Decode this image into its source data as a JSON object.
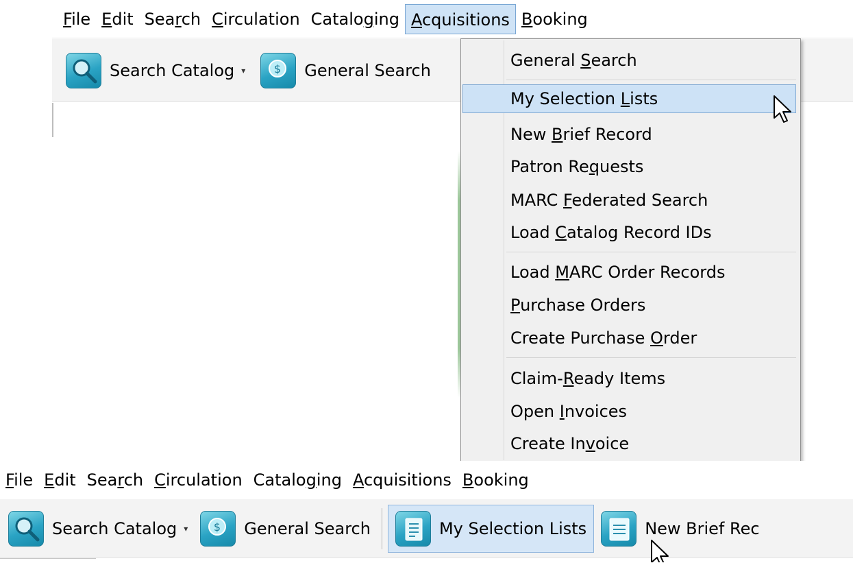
{
  "top_window": {
    "menubar": [
      {
        "label": "File",
        "u": "F",
        "rest": "ile",
        "pre": ""
      },
      {
        "label": "Edit",
        "u": "E",
        "rest": "dit",
        "pre": ""
      },
      {
        "label": "Search",
        "pre": "Sea",
        "u": "r",
        "rest": "ch"
      },
      {
        "label": "Circulation",
        "pre": "",
        "u": "C",
        "rest": "irculation"
      },
      {
        "label": "Cataloging",
        "pre": "Catalo",
        "u": "g",
        "rest": "ing"
      },
      {
        "label": "Acquisitions",
        "pre": "",
        "u": "A",
        "rest": "cquisitions"
      },
      {
        "label": "Booking",
        "pre": "",
        "u": "B",
        "rest": "ooking"
      }
    ],
    "toolbar": {
      "search_catalog": "Search Catalog",
      "general_search": "General Search"
    }
  },
  "acquisitions_menu": {
    "items": [
      {
        "pre": "General ",
        "u": "S",
        "rest": "earch"
      },
      {
        "pre": "My Selection ",
        "u": "L",
        "rest": "ists"
      },
      {
        "pre": "New ",
        "u": "B",
        "rest": "rief Record"
      },
      {
        "pre": "Patron Re",
        "u": "q",
        "rest": "uests"
      },
      {
        "pre": "MARC ",
        "u": "F",
        "rest": "ederated Search"
      },
      {
        "pre": "Load ",
        "u": "C",
        "rest": "atalog Record IDs"
      },
      {
        "pre": "Load ",
        "u": "M",
        "rest": "ARC Order Records"
      },
      {
        "pre": "",
        "u": "P",
        "rest": "urchase Orders"
      },
      {
        "pre": "Create Purchase ",
        "u": "O",
        "rest": "rder"
      },
      {
        "pre": "Claim-",
        "u": "R",
        "rest": "eady Items"
      },
      {
        "pre": "Open ",
        "u": "I",
        "rest": "nvoices"
      },
      {
        "pre": "Create In",
        "u": "v",
        "rest": "oice"
      }
    ],
    "highlighted": "My Selection Lists"
  },
  "bottom_window": {
    "menubar": [
      {
        "label": "File",
        "pre": "",
        "u": "F",
        "rest": "ile"
      },
      {
        "label": "Edit",
        "pre": "",
        "u": "E",
        "rest": "dit"
      },
      {
        "label": "Search",
        "pre": "Sea",
        "u": "r",
        "rest": "ch"
      },
      {
        "label": "Circulation",
        "pre": "",
        "u": "C",
        "rest": "irculation"
      },
      {
        "label": "Cataloging",
        "pre": "Catalo",
        "u": "g",
        "rest": "ing"
      },
      {
        "label": "Acquisitions",
        "pre": "",
        "u": "A",
        "rest": "cquisitions"
      },
      {
        "label": "Booking",
        "pre": "",
        "u": "B",
        "rest": "ooking"
      }
    ],
    "toolbar": {
      "search_catalog": "Search Catalog",
      "general_search": "General Search",
      "my_selection_lists": "My Selection Lists",
      "new_brief_record": "New Brief Rec"
    }
  },
  "icons": {
    "search_catalog": "magnifier-icon",
    "general_search": "coin-search-icon",
    "my_selection_lists": "list-icon",
    "new_brief_record": "document-icon"
  },
  "colors": {
    "highlight": "#cde2f6",
    "highlight_border": "#80a9d3",
    "icon_teal": "#2aa3c4"
  }
}
